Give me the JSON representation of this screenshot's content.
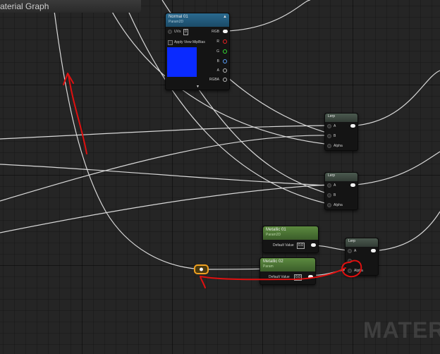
{
  "graph": {
    "title": "Material Graph",
    "watermark": "MATERI"
  },
  "nodes": {
    "normal": {
      "title": "Normal 01",
      "subtitle": "Param2D",
      "uvs_label": "UVs",
      "uvs_value": "0",
      "mip_label": "Apply View MipBias",
      "outputs": [
        "RGB",
        "R",
        "G",
        "B",
        "A",
        "RGBA"
      ],
      "preview_color": "#0a2aff"
    },
    "lerp1": {
      "title": "Lerp",
      "inputs": [
        "A",
        "B",
        "Alpha"
      ]
    },
    "lerp2": {
      "title": "Lerp",
      "inputs": [
        "A",
        "B",
        "Alpha"
      ]
    },
    "lerp3": {
      "title": "Lerp",
      "inputs": [
        "A",
        "B",
        "Alpha"
      ]
    },
    "metallic1": {
      "title": "Metallic 01",
      "subtitle": "Param2D",
      "field_label": "Default Value",
      "field_value": "0.0"
    },
    "metallic2": {
      "title": "Metallic 02",
      "subtitle": "Param",
      "field_label": "Default Value",
      "field_value": "0.0"
    }
  },
  "annotation": {
    "color": "#e01010",
    "highlight_color": "#f0a020"
  }
}
